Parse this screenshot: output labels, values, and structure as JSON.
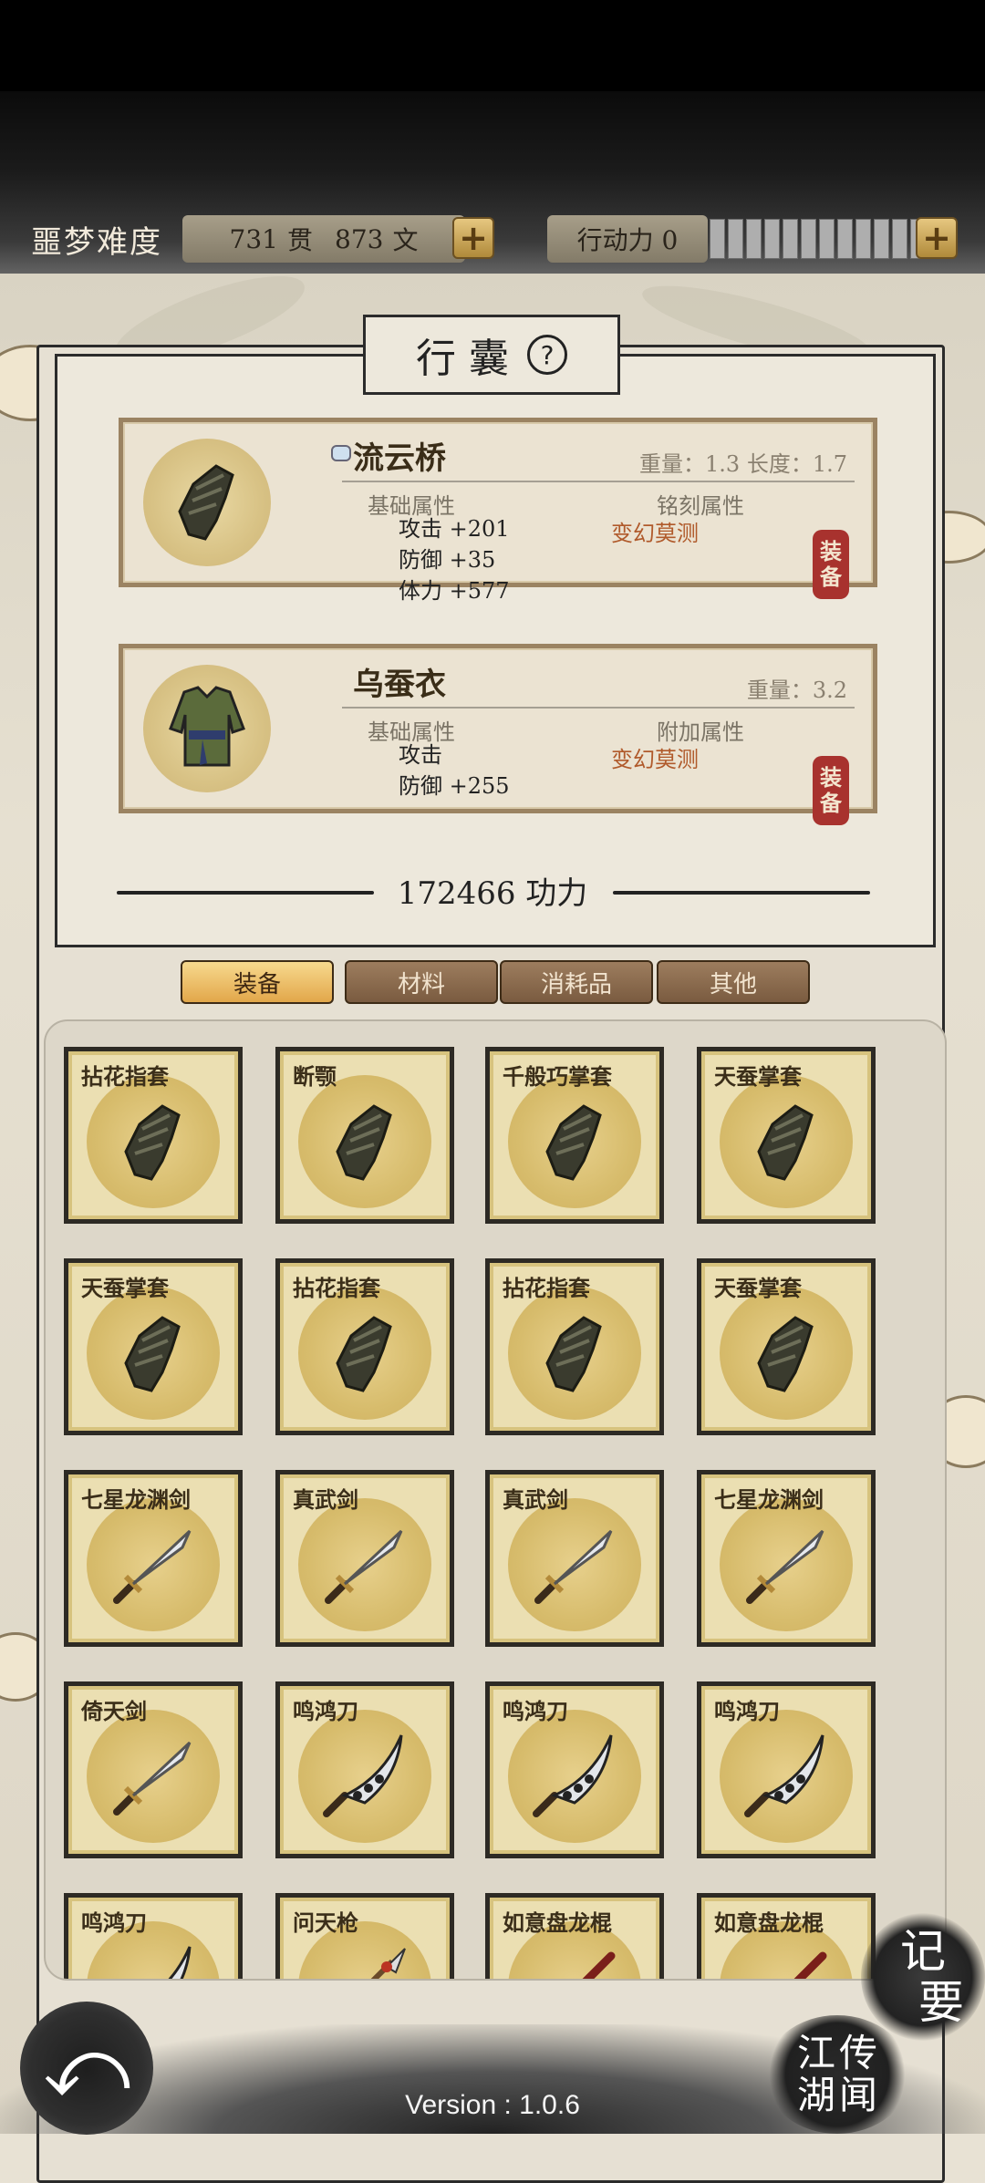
{
  "header": {
    "difficulty": "噩梦难度",
    "money": {
      "guan_value": "731",
      "guan_unit": "贯",
      "wen_value": "873",
      "wen_unit": "文"
    },
    "stamina_label": "行动力 0",
    "stamina_fill": 0,
    "plus_symbol": "+"
  },
  "bag": {
    "title": "行 囊",
    "help_symbol": "?",
    "equipped": [
      {
        "name": "流云桥",
        "weight": "重量：1.3  长度：1.7",
        "base_header": "基础属性",
        "extra_header": "铭刻属性",
        "extra_value": "变幻莫测",
        "stats": [
          "攻击 +201",
          "防御 +35",
          "体力 +577"
        ],
        "equip_1": "装",
        "equip_2": "备"
      },
      {
        "name": "乌蚕衣",
        "weight": "重量：3.2",
        "base_header": "基础属性",
        "extra_header": "附加属性",
        "extra_value": "变幻莫测",
        "stats": [
          "攻击",
          "防御 +255"
        ],
        "equip_1": "装",
        "equip_2": "备"
      }
    ],
    "power": "172466 功力"
  },
  "tabs": [
    {
      "label": "装备",
      "active": true
    },
    {
      "label": "材料",
      "active": false
    },
    {
      "label": "消耗品",
      "active": false
    },
    {
      "label": "其他",
      "active": false
    }
  ],
  "items": [
    {
      "name": "拈花指套",
      "icon": "gauntlet-icon"
    },
    {
      "name": "断颚",
      "icon": "gauntlet-icon"
    },
    {
      "name": "千般巧掌套",
      "icon": "gauntlet-icon"
    },
    {
      "name": "天蚕掌套",
      "icon": "gauntlet-icon"
    },
    {
      "name": "天蚕掌套",
      "icon": "gauntlet-icon"
    },
    {
      "name": "拈花指套",
      "icon": "gauntlet-icon"
    },
    {
      "name": "拈花指套",
      "icon": "gauntlet-icon"
    },
    {
      "name": "天蚕掌套",
      "icon": "gauntlet-icon"
    },
    {
      "name": "七星龙渊剑",
      "icon": "sword-icon"
    },
    {
      "name": "真武剑",
      "icon": "sword-icon"
    },
    {
      "name": "真武剑",
      "icon": "sword-icon"
    },
    {
      "name": "七星龙渊剑",
      "icon": "sword-icon"
    },
    {
      "name": "倚天剑",
      "icon": "sword-icon"
    },
    {
      "name": "鸣鸿刀",
      "icon": "saber-icon"
    },
    {
      "name": "鸣鸿刀",
      "icon": "saber-icon"
    },
    {
      "name": "鸣鸿刀",
      "icon": "saber-icon"
    },
    {
      "name": "鸣鸿刀",
      "icon": "saber-icon"
    },
    {
      "name": "问天枪",
      "icon": "spear-icon"
    },
    {
      "name": "如意盘龙棍",
      "icon": "staff-icon"
    },
    {
      "name": "如意盘龙棍",
      "icon": "staff-icon"
    }
  ],
  "footer": {
    "back_symbol": "⤺",
    "jiyao_1": "记",
    "jiyao_2": "要",
    "jianghu_1": "江",
    "jianghu_2": "湖",
    "jianghu_3": "传",
    "jianghu_4": "闻",
    "version": "Version : 1.0.6"
  }
}
